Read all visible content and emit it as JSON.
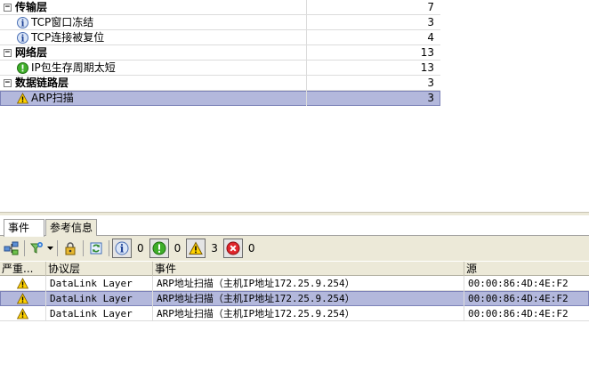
{
  "tree": {
    "rows": [
      {
        "kind": "group",
        "expander": "⊟",
        "label": "传输层",
        "count": "7"
      },
      {
        "kind": "child",
        "icon": "info-icon",
        "label": "TCP窗口冻结",
        "count": "3"
      },
      {
        "kind": "child",
        "icon": "info-icon",
        "label": "TCP连接被复位",
        "count": "4"
      },
      {
        "kind": "group",
        "expander": "⊟",
        "label": "网络层",
        "count": "13"
      },
      {
        "kind": "child",
        "icon": "notice-icon",
        "label": "IP包生存周期太短",
        "count": "13"
      },
      {
        "kind": "group",
        "expander": "⊟",
        "label": "数据链路层",
        "count": "3"
      },
      {
        "kind": "child",
        "icon": "warning-icon",
        "label": "ARP扫描",
        "count": "3",
        "selected": true
      }
    ]
  },
  "tabs": [
    {
      "label": "事件",
      "active": true
    },
    {
      "label": "参考信息",
      "active": false
    }
  ],
  "toolbar": {
    "info_count": "0",
    "notice_count": "0",
    "warning_count": "3",
    "error_count": "0"
  },
  "grid": {
    "headers": {
      "severity": "严重...",
      "protocol": "协议层",
      "event": "事件",
      "source": "源"
    },
    "rows": [
      {
        "severity": "warning-icon",
        "protocol": "DataLink Layer",
        "event": "ARP地址扫描（主机IP地址172.25.9.254）",
        "source": "00:00:86:4D:4E:F2",
        "selected": false
      },
      {
        "severity": "warning-icon",
        "protocol": "DataLink Layer",
        "event": "ARP地址扫描（主机IP地址172.25.9.254）",
        "source": "00:00:86:4D:4E:F2",
        "selected": true
      },
      {
        "severity": "warning-icon",
        "protocol": "DataLink Layer",
        "event": "ARP地址扫描（主机IP地址172.25.9.254）",
        "source": "00:00:86:4D:4E:F2",
        "selected": false
      }
    ]
  },
  "colors": {
    "selection": "#b3b8dc",
    "toolbar_bg": "#ece9d8"
  }
}
